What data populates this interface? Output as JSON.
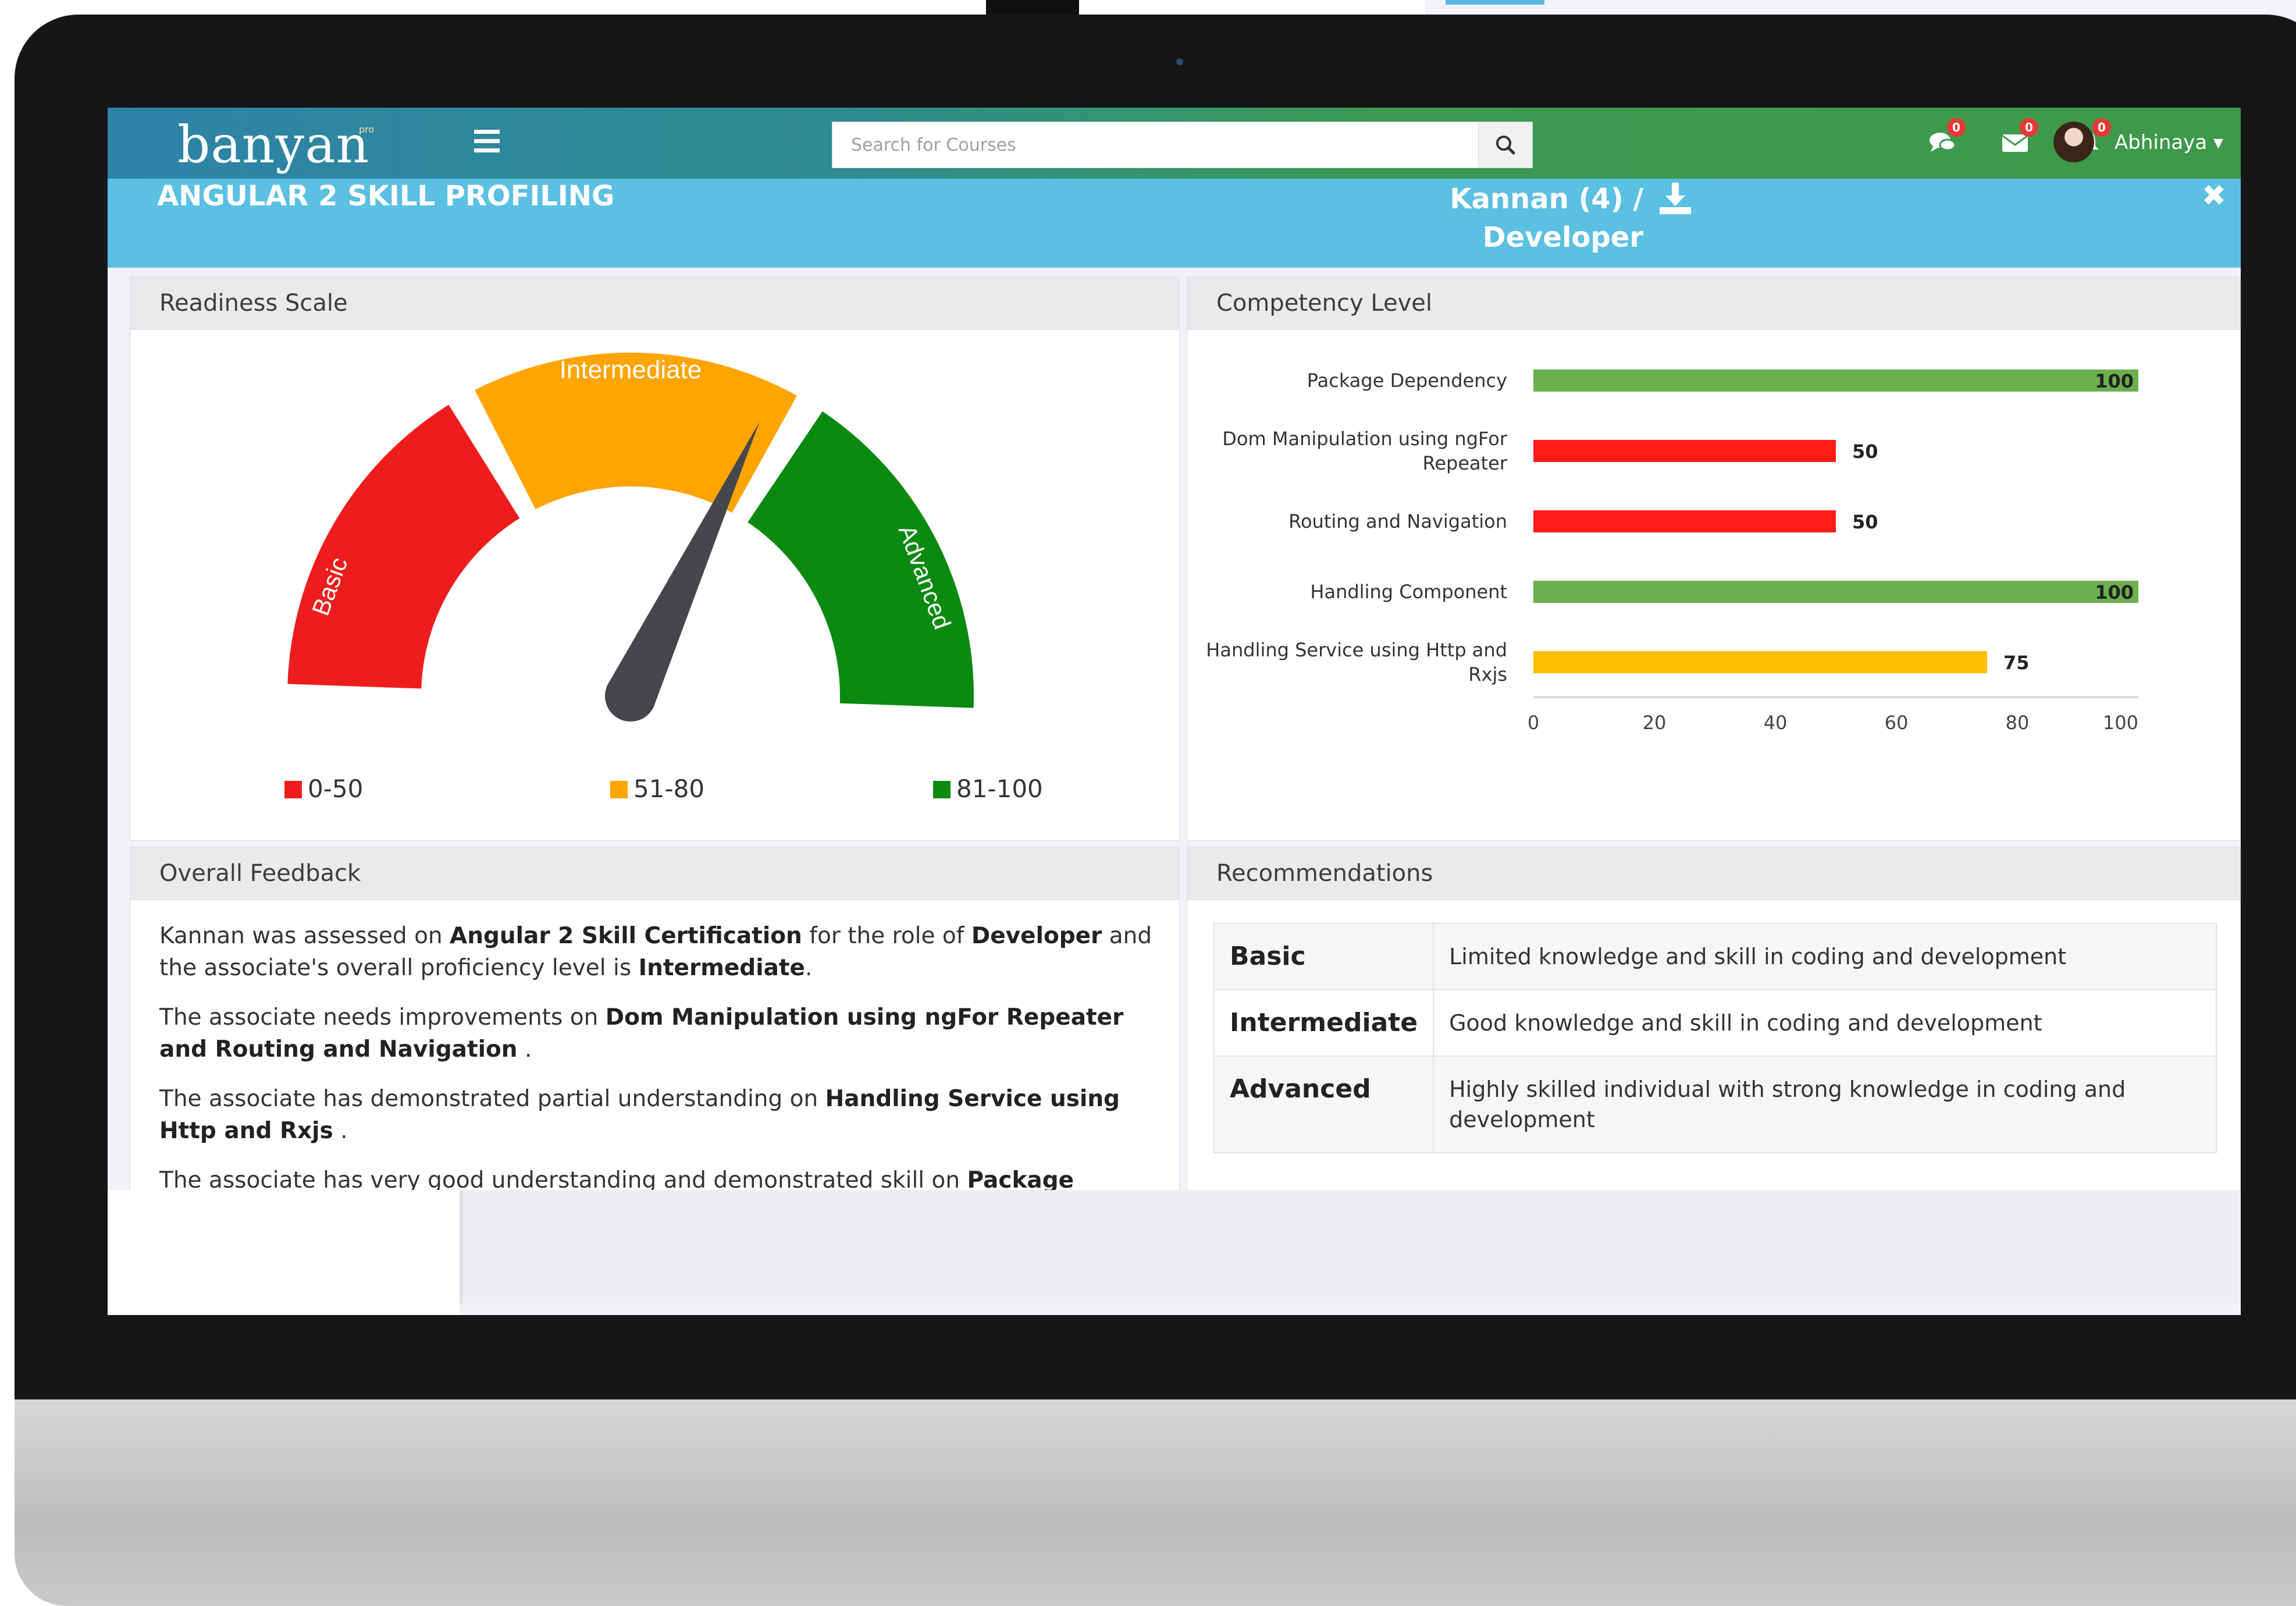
{
  "app": {
    "logo_text": "banyan",
    "logo_suffix": "pro"
  },
  "search": {
    "placeholder": "Search for Courses"
  },
  "notifications": {
    "chat_count": "0",
    "mail_count": "0",
    "alert_count": "0"
  },
  "user": {
    "name": "Abhinaya ▾"
  },
  "header": {
    "title": "ANGULAR 2 SKILL PROFILING",
    "assessee_line1": "Kannan (4) /",
    "assessee_line2": "Developer"
  },
  "readiness": {
    "title": "Readiness Scale",
    "bands": [
      {
        "label": "Basic",
        "range": "0-50",
        "color": "#ee1d1d"
      },
      {
        "label": "Intermediate",
        "range": "51-80",
        "color": "#ffa400"
      },
      {
        "label": "Advanced",
        "range": "81-100",
        "color": "#0a8a10"
      }
    ],
    "needle_value": 64,
    "needle_color": "#45474b"
  },
  "competency": {
    "title": "Competency Level"
  },
  "chart_data": {
    "type": "bar",
    "orientation": "horizontal",
    "categories": [
      [
        "Package Dependency"
      ],
      [
        "Dom Manipulation using ngFor",
        "Repeater"
      ],
      [
        "Routing and Navigation"
      ],
      [
        "Handling Component"
      ],
      [
        "Handling Service using Http and",
        "Rxjs"
      ]
    ],
    "values": [
      100,
      50,
      50,
      100,
      75
    ],
    "value_labels": [
      "100",
      "50",
      "50",
      "100",
      "75"
    ],
    "colors": [
      "#6ab04c",
      "#ff1a1a",
      "#ff1a1a",
      "#6ab04c",
      "#ffbf00"
    ],
    "xlim": [
      0,
      100
    ],
    "xticks": [
      "0",
      "20",
      "40",
      "60",
      "80",
      "100"
    ],
    "grid": false,
    "legend": "none"
  },
  "feedback": {
    "title": "Overall Feedback",
    "p1": {
      "t1": "Kannan was assessed on ",
      "b1": "Angular 2 Skill Certification",
      "t2": " for the role of ",
      "b2": "Developer",
      "t3": " and the associate's overall proficiency level is ",
      "b3": "Intermediate",
      "t4": "."
    },
    "p2": {
      "t1": "The associate needs improvements on ",
      "b1": "Dom Manipulation using ngFor Repeater and Routing and Navigation",
      "t2": " ."
    },
    "p3": {
      "t1": "The associate has demonstrated partial understanding on ",
      "b1": "Handling Service using Http and Rxjs",
      "t2": " ."
    },
    "p4": {
      "t1": "The associate has very good understanding and demonstrated skill on ",
      "b1": "Package Dependency"
    }
  },
  "recommendations": {
    "title": "Recommendations",
    "rows": [
      {
        "level": "Basic",
        "desc": "Limited knowledge and skill in coding and development"
      },
      {
        "level": "Intermediate",
        "desc": "Good knowledge and skill in coding and development"
      },
      {
        "level": "Advanced",
        "desc": "Highly skilled individual with strong knowledge in coding and development"
      }
    ]
  }
}
